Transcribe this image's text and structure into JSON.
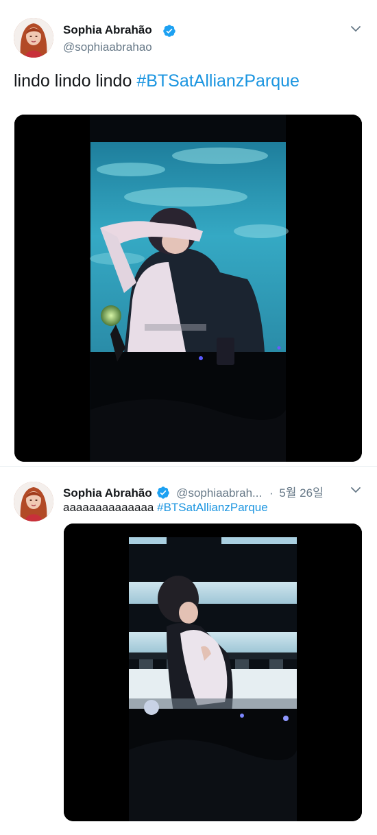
{
  "tweets": [
    {
      "author_name": "Sophia Abrahão",
      "author_handle": "@sophiaabrahao",
      "text": "lindo lindo lindo",
      "hashtag": "#BTSatAllianzParque"
    },
    {
      "author_name": "Sophia Abrahão",
      "author_handle": "@sophiaabrah...",
      "separator": "·",
      "date": "5월 26일",
      "text": "aaaaaaaaaaaaaa",
      "hashtag": "#BTSatAllianzParque"
    }
  ],
  "colors": {
    "link": "#1b95e0",
    "verified": "#1da1f2",
    "secondary_text": "#657786",
    "media_background": "#000000"
  },
  "icons": {
    "verified": "verified-badge-icon",
    "chevron": "chevron-down-icon"
  }
}
